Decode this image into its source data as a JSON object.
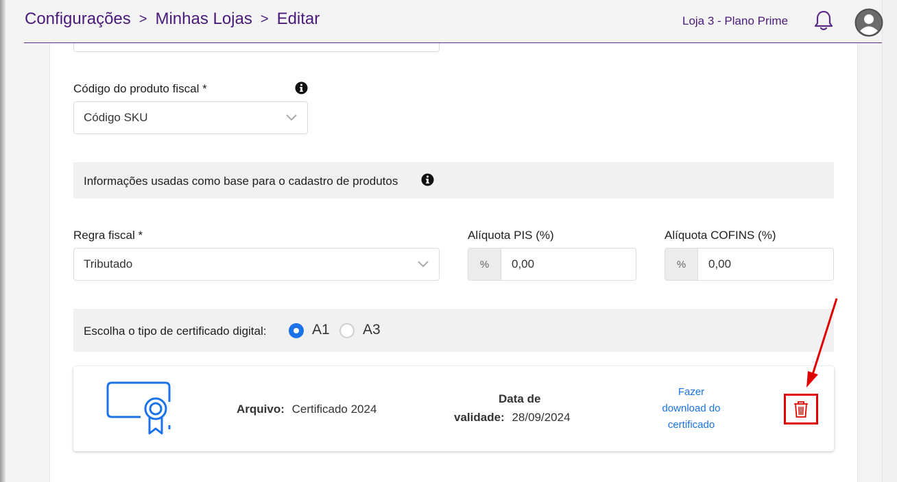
{
  "header": {
    "breadcrumb": [
      "Configurações",
      "Minhas Lojas",
      "Editar"
    ],
    "separator": ">",
    "store_label": "Loja 3 - Plano Prime",
    "bell_icon": "bell-icon",
    "avatar_icon": "user-avatar-icon"
  },
  "fiscal_product_code": {
    "label": "Código do produto fiscal *",
    "selected": "Código SKU"
  },
  "base_info": {
    "title": "Informações usadas como base para o cadastro de produtos"
  },
  "fiscal_rule": {
    "label": "Regra fiscal *",
    "selected": "Tributado"
  },
  "pis": {
    "label": "Alíquota PIS (%)",
    "addon": "%",
    "value": "0,00"
  },
  "cofins": {
    "label": "Alíquota COFINS (%)",
    "addon": "%",
    "value": "0,00"
  },
  "certificate_type": {
    "label": "Escolha o tipo de certificado digital:",
    "options": [
      {
        "label": "A1",
        "selected": true
      },
      {
        "label": "A3",
        "selected": false
      }
    ]
  },
  "certificate": {
    "file_label": "Arquivo:",
    "file_value": "Certificado 2024",
    "validity_label_line1": "Data de",
    "validity_label_line2": "validade:",
    "validity_value": "28/09/2024",
    "download_line1": "Fazer",
    "download_line2": "download do",
    "download_line3": "certificado"
  },
  "colors": {
    "brand_purple": "#4a1a7a",
    "accent_blue": "#1a73e8",
    "highlight_red": "#e00000"
  }
}
